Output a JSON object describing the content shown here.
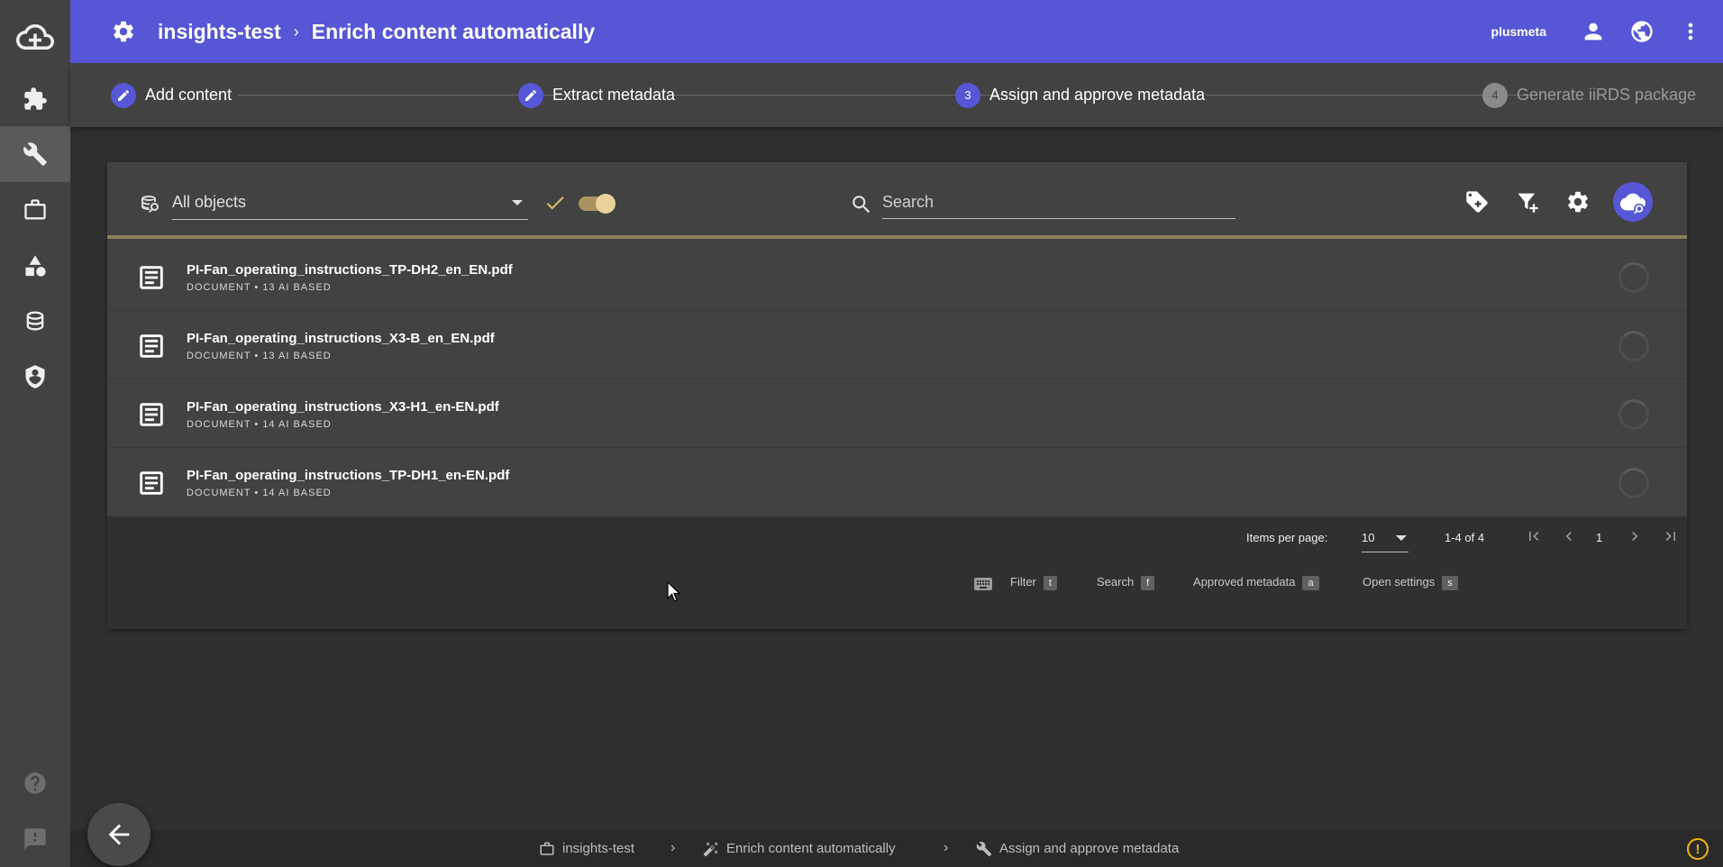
{
  "topbar": {
    "project": "insights-test",
    "chevron": "›",
    "title": "Enrich content automatically",
    "user": "plusmeta",
    "icons": [
      "gear-icon",
      "person-icon",
      "globe-icon",
      "more-vert-icon"
    ]
  },
  "sidebar": {
    "items": [
      "cloud-add-icon",
      "puzzle-icon",
      "wrench-icon",
      "briefcase-icon",
      "shapes-icon",
      "database-icon",
      "shield-user-icon",
      "help-icon",
      "feedback-icon"
    ],
    "active": "wrench-icon"
  },
  "stepper": {
    "steps": [
      {
        "label": "Add content",
        "marker": "edit-icon",
        "state": "done"
      },
      {
        "label": "Extract metadata",
        "marker": "edit-icon",
        "state": "done"
      },
      {
        "label": "Assign and approve metadata",
        "marker": "3",
        "state": "active"
      },
      {
        "label": "Generate iiRDS package",
        "marker": "4",
        "state": "inactive"
      }
    ]
  },
  "filter": {
    "selected": "All objects",
    "search_placeholder": "Search",
    "approved_toggle": true
  },
  "toolbar": {
    "icons": [
      "tag-add-icon",
      "filter-add-icon",
      "settings-icon",
      "cloud-search-icon"
    ]
  },
  "documents": [
    {
      "name": "PI-Fan_operating_instructions_TP-DH2_en_EN.pdf",
      "meta": "DOCUMENT • 13 AI BASED"
    },
    {
      "name": "PI-Fan_operating_instructions_X3-B_en_EN.pdf",
      "meta": "DOCUMENT • 13 AI BASED"
    },
    {
      "name": "PI-Fan_operating_instructions_X3-H1_en-EN.pdf",
      "meta": "DOCUMENT • 14 AI BASED"
    },
    {
      "name": "PI-Fan_operating_instructions_TP-DH1_en-EN.pdf",
      "meta": "DOCUMENT • 14 AI BASED"
    }
  ],
  "paginator": {
    "items_per_page_label": "Items per page:",
    "items_per_page": "10",
    "range": "1-4 of 4",
    "page": "1"
  },
  "shortcuts": [
    {
      "label": "Filter",
      "key": "t"
    },
    {
      "label": "Search",
      "key": "f"
    },
    {
      "label": "Approved metadata",
      "key": "a"
    },
    {
      "label": "Open settings",
      "key": "s"
    }
  ],
  "breadcrumb": {
    "items": [
      "insights-test",
      "Enrich content automatically",
      "Assign and approve metadata"
    ],
    "separator": "›"
  },
  "warning_symbol": "!",
  "colors": {
    "accent": "#5656d6",
    "highlight": "#d1b96a",
    "warning": "#f2b705"
  }
}
